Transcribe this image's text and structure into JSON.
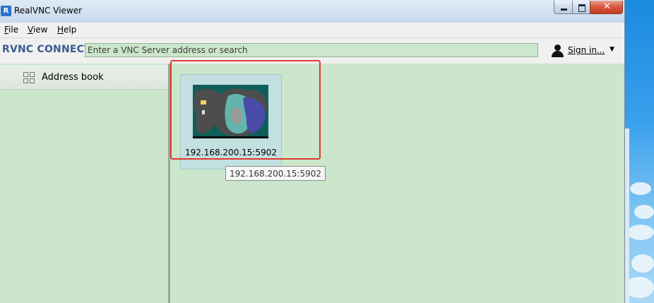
{
  "window": {
    "title": "RealVNC Viewer",
    "app_icon": "R",
    "minimize_label": "minimize",
    "maximize_label": "maximize",
    "close_glyph": "✕"
  },
  "menu": {
    "file": {
      "underline": "F",
      "rest": "ile"
    },
    "view": {
      "underline": "V",
      "rest": "iew"
    },
    "help": {
      "underline": "H",
      "rest": "elp"
    }
  },
  "toolbar": {
    "logo": "RVNC CONNECT",
    "search_placeholder": "Enter a VNC Server address or search",
    "signin_label": "Sign in...",
    "signin_chevron": "▼"
  },
  "sidebar": {
    "items": [
      {
        "label": "Address book",
        "icon": "grid-icon"
      }
    ]
  },
  "main": {
    "connections": [
      {
        "label": "192.168.200.15:5902",
        "tooltip": "192.168.200.15:5902"
      }
    ]
  },
  "colors": {
    "content_bg": "#cbe6cb",
    "card_bg": "#c2e0df",
    "highlight": "#e03a2e",
    "logo": "#3a5a8e"
  }
}
